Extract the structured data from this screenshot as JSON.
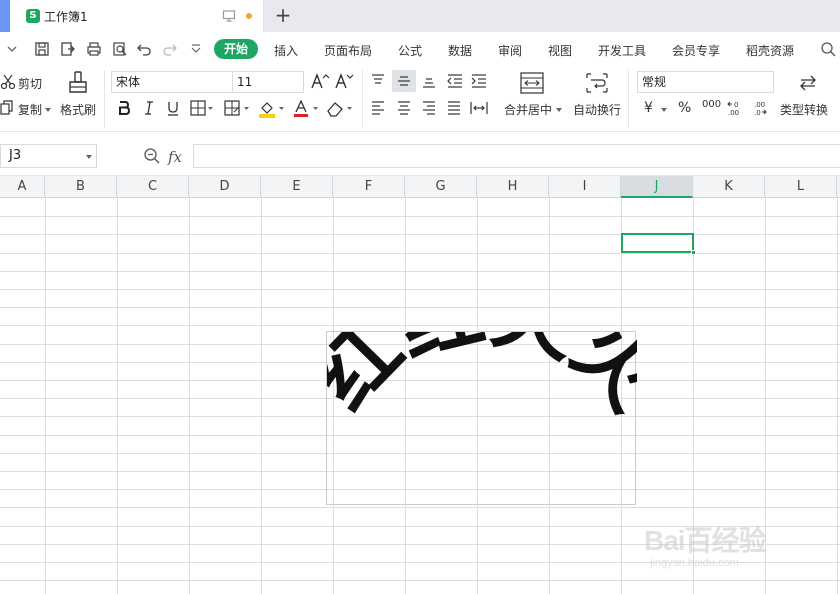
{
  "titlebar": {
    "tab_title": "工作簿1",
    "app_icon_letter": "S",
    "new_tab": "+"
  },
  "menu": {
    "items": [
      "开始",
      "插入",
      "页面布局",
      "公式",
      "数据",
      "审阅",
      "视图",
      "开发工具",
      "会员专享",
      "稻壳资源"
    ],
    "active": "开始"
  },
  "ribbon": {
    "cut": "剪切",
    "copy": "复制",
    "format_painter": "格式刷",
    "font_name": "宋体",
    "font_size": "11",
    "merge_center": "合并居中",
    "wrap_text": "自动换行",
    "number_format": "常规",
    "type_convert": "类型转换",
    "percent": "%",
    "thousands": "000",
    "currency": "¥"
  },
  "formula_bar": {
    "name_box": "J3",
    "fx": "fx",
    "value": ""
  },
  "columns": [
    "A",
    "B",
    "C",
    "D",
    "E",
    "F",
    "G",
    "H",
    "I",
    "J",
    "K",
    "L"
  ],
  "selected_column": "J",
  "selected_cell": "J3",
  "wordart": {
    "text": "红红火火"
  },
  "watermark": {
    "line1": "Bai百经验",
    "line2": "jingyan.baidu.com"
  },
  "colors": {
    "accent": "#1ea663",
    "tab_strip": "#6c96f3",
    "dot": "#f2a33a"
  }
}
